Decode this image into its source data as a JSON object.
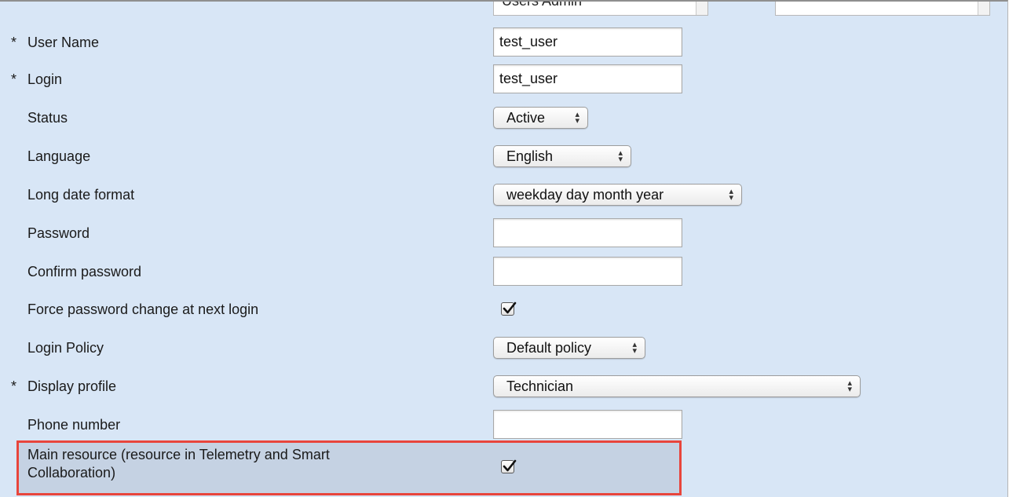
{
  "top_row": {
    "role_value": "Users Admin",
    "second_value": ""
  },
  "form": {
    "required_marker": "*",
    "user_name": {
      "label": "User Name",
      "value": "test_user",
      "required": true
    },
    "login": {
      "label": "Login",
      "value": "test_user",
      "required": true
    },
    "status": {
      "label": "Status",
      "value": "Active"
    },
    "language": {
      "label": "Language",
      "value": "English"
    },
    "long_date_format": {
      "label": "Long date format",
      "value": "weekday day month year"
    },
    "password": {
      "label": "Password",
      "value": ""
    },
    "confirm_password": {
      "label": "Confirm password",
      "value": ""
    },
    "force_password_change": {
      "label": "Force password change at next login",
      "checked": true
    },
    "login_policy": {
      "label": "Login Policy",
      "value": "Default policy"
    },
    "display_profile": {
      "label": "Display profile",
      "value": "Technician",
      "required": true
    },
    "phone_number": {
      "label": "Phone number",
      "value": ""
    },
    "main_resource": {
      "label_line1": "Main resource (resource in Telemetry and Smart",
      "label_line2": "Collaboration)",
      "checked": true
    }
  },
  "colors": {
    "background": "#d8e6f6",
    "highlight_fill": "#c5d2e3",
    "highlight_border": "#e8453c"
  }
}
